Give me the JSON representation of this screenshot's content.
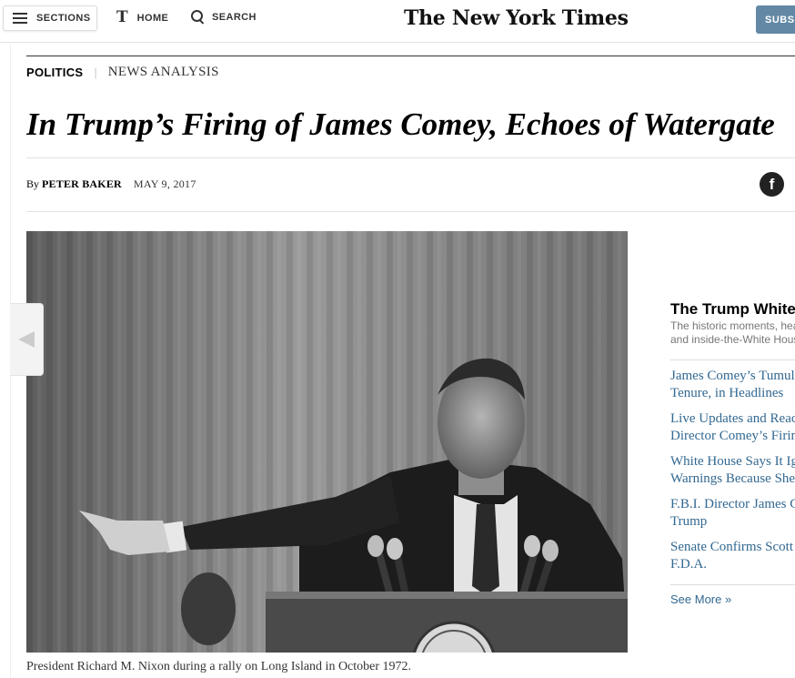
{
  "header": {
    "sections_label": "SECTIONS",
    "home_label": "HOME",
    "search_label": "SEARCH",
    "logo_text": "The New York Times",
    "subscribe_label": "SUBSCRIBE",
    "t_glyph": "T"
  },
  "article": {
    "section": "POLITICS",
    "separator": "|",
    "kicker": "NEWS ANALYSIS",
    "headline": "In Trump’s Firing of James Comey, Echoes of Watergate",
    "byline_prefix": "By",
    "author": "PETER BAKER",
    "date": "MAY 9, 2017",
    "share_glyph": "f",
    "caption": "President Richard M. Nixon during a rally on Long Island in October 1972."
  },
  "rail": {
    "title": "The Trump White House",
    "description_lines": [
      "The historic moments, headlines",
      "and inside-the-White House"
    ],
    "stories": [
      {
        "line1": "James Comey’s Tumultuous",
        "line2": "Tenure, in Headlines"
      },
      {
        "line1": "Live Updates and Reactions to",
        "line2": "Director Comey’s Firing"
      },
      {
        "line1": "White House Says It Ignored",
        "line2": "Warnings Because She"
      },
      {
        "line1": "F.B.I. Director James Comey",
        "line2": "Trump"
      },
      {
        "line1": "Senate Confirms Scott Gottlieb",
        "line2": "F.D.A."
      }
    ],
    "see_more": "See More »"
  },
  "colors": {
    "link_blue": "#326891",
    "subscribe_bg": "#6288a5"
  }
}
